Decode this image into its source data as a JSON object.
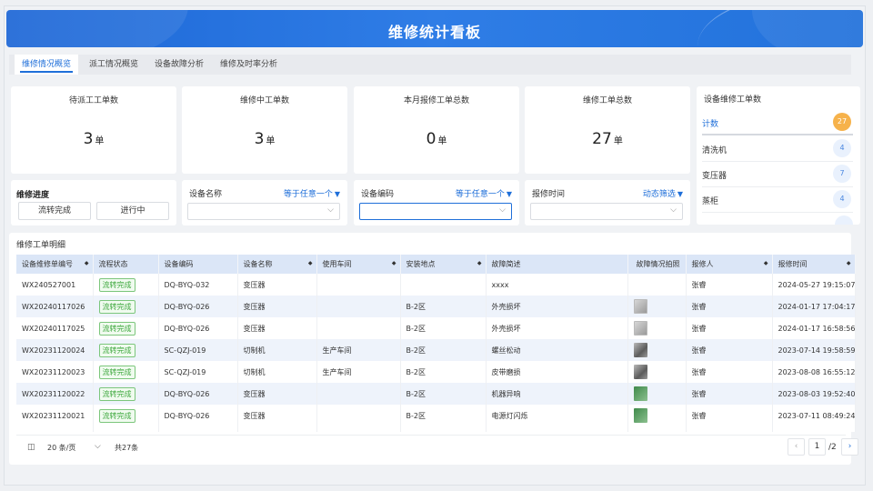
{
  "header": {
    "title": "维修统计看板"
  },
  "tabs": [
    {
      "label": "维修情况概览",
      "active": true
    },
    {
      "label": "派工情况概览",
      "active": false
    },
    {
      "label": "设备故障分析",
      "active": false
    },
    {
      "label": "维修及时率分析",
      "active": false
    }
  ],
  "stats": [
    {
      "title": "待派工工单数",
      "value": "3",
      "unit": "单"
    },
    {
      "title": "维修中工单数",
      "value": "3",
      "unit": "单"
    },
    {
      "title": "本月报修工单总数",
      "value": "0",
      "unit": "单"
    },
    {
      "title": "维修工单总数",
      "value": "27",
      "unit": "单"
    }
  ],
  "device_counts": {
    "title": "设备维修工单数",
    "rows": [
      {
        "name": "计数",
        "count": "27"
      },
      {
        "name": "清洗机",
        "count": "4"
      },
      {
        "name": "变压器",
        "count": "7"
      },
      {
        "name": "蒸柜",
        "count": "4"
      }
    ]
  },
  "progress": {
    "title": "维修进度",
    "buttons": [
      "流转完成",
      "进行中"
    ]
  },
  "filters": [
    {
      "label": "设备名称",
      "mode": "等于任意一个",
      "value": ""
    },
    {
      "label": "设备编码",
      "mode": "等于任意一个",
      "value": ""
    },
    {
      "label": "报修时间",
      "mode": "动态筛选",
      "value": ""
    }
  ],
  "detail": {
    "title": "维修工单明细",
    "columns": [
      "设备维修单编号",
      "流程状态",
      "设备编码",
      "设备名称",
      "使用车间",
      "安装地点",
      "故障简述",
      "故障情况拍照",
      "报修人",
      "报修时间"
    ],
    "rows": [
      {
        "id": "WX240527001",
        "status": "流转完成",
        "code": "DQ-BYQ-032",
        "name": "变压器",
        "workshop": "",
        "location": "",
        "fault": "xxxx",
        "photo": "none",
        "reporter": "张睿",
        "time": "2024-05-27 19:15:07"
      },
      {
        "id": "WX20240117026",
        "status": "流转完成",
        "code": "DQ-BYQ-026",
        "name": "变压器",
        "workshop": "",
        "location": "B-2区",
        "fault": "外壳损坏",
        "photo": "gray",
        "reporter": "张睿",
        "time": "2024-01-17 17:04:17"
      },
      {
        "id": "WX20240117025",
        "status": "流转完成",
        "code": "DQ-BYQ-026",
        "name": "变压器",
        "workshop": "",
        "location": "B-2区",
        "fault": "外壳损坏",
        "photo": "gray",
        "reporter": "张睿",
        "time": "2024-01-17 16:58:56"
      },
      {
        "id": "WX20231120024",
        "status": "流转完成",
        "code": "SC-QZJ-019",
        "name": "切制机",
        "workshop": "生产车间",
        "location": "B-2区",
        "fault": "螺丝松动",
        "photo": "dark",
        "reporter": "张睿",
        "time": "2023-07-14 19:58:59"
      },
      {
        "id": "WX20231120023",
        "status": "流转完成",
        "code": "SC-QZJ-019",
        "name": "切制机",
        "workshop": "生产车间",
        "location": "B-2区",
        "fault": "皮带磨损",
        "photo": "dark",
        "reporter": "张睿",
        "time": "2023-08-08 16:55:12"
      },
      {
        "id": "WX20231120022",
        "status": "流转完成",
        "code": "DQ-BYQ-026",
        "name": "变压器",
        "workshop": "",
        "location": "B-2区",
        "fault": "机器异响",
        "photo": "green",
        "reporter": "张睿",
        "time": "2023-08-03 19:52:40"
      },
      {
        "id": "WX20231120021",
        "status": "流转完成",
        "code": "DQ-BYQ-026",
        "name": "变压器",
        "workshop": "",
        "location": "B-2区",
        "fault": "电源灯闪烁",
        "photo": "green",
        "reporter": "张睿",
        "time": "2023-07-11 08:49:24"
      }
    ]
  },
  "pagination": {
    "page_size": "20 条/页",
    "total": "共27条",
    "current": "1",
    "pages": "/2"
  }
}
